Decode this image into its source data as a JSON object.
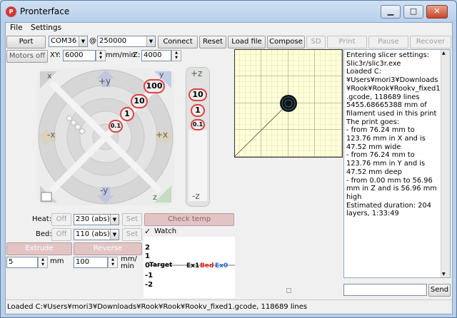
{
  "window": {
    "title": "Pronterface",
    "minimize": "▁",
    "maximize": "□",
    "close": "✕"
  },
  "menu": {
    "file": "File",
    "settings": "Settings"
  },
  "toolbar": {
    "port_label": "Port",
    "port_value": "COM36",
    "at": "@",
    "baud_value": "250000",
    "connect": "Connect",
    "reset": "Reset",
    "load_file": "Load file",
    "compose": "Compose",
    "sd": "SD",
    "print": "Print",
    "pause": "Pause",
    "recover": "Recover"
  },
  "motors": {
    "off_label": "Motors off",
    "xy_label": "XY:",
    "xy_value": "6000",
    "mm_min_label": "mm/min",
    "z_label": "Z:",
    "z_value": "4000"
  },
  "jog": {
    "y_plus": "+y",
    "y_minus": "-y",
    "x_minus": "-x",
    "x_plus": "+x",
    "y_home": "y",
    "x_home": "x",
    "z_home": "z",
    "steps": [
      "100",
      "10",
      "1",
      "0.1"
    ],
    "z_plus": "+z",
    "z_minus": "-z",
    "z_steps": [
      "10",
      "1",
      "0.1"
    ]
  },
  "temp": {
    "heat_label": "Heat:",
    "bed_label": "Bed:",
    "off": "Off",
    "heat_value": "230 (abs)",
    "bed_value": "110 (abs)",
    "set": "Set",
    "check_temp": "Check temp",
    "watch": "Watch"
  },
  "extrude": {
    "extrude": "Extrude",
    "reverse": "Reverse",
    "length": "5",
    "length_unit": "mm",
    "speed": "100",
    "speed_unit": "mm/\nmin"
  },
  "graph": {
    "ticks": [
      "2",
      "1",
      "0",
      "-1",
      "-2"
    ],
    "target": "Target",
    "ex1": "Ex1",
    "bed": "Bed",
    "ex0": "Ex0"
  },
  "console": {
    "log": "Entering slicer settings: Slic3r/slic3r.exe\nLoaded C:¥Users¥mori3¥Downloads¥Rook¥Rook¥Rookv_fixed1.gcode, 118689 lines\n5455.68665388 mm of filament used in this print\nThe print goes:\n- from 76.24 mm to 123.76 mm in X and is 47.52 mm wide\n- from 76.24 mm to 123.76 mm in Y and is 47.52 mm deep\n- from 0.00 mm to 56.96 mm in Z and is 56.96 mm high\nEstimated duration: 204 layers, 1:33:49",
    "send": "Send"
  },
  "status": "Loaded C:¥Users¥mori3¥Downloads¥Rook¥Rook¥Rookv_fixed1.gcode, 118689 lines",
  "colors": {
    "red": "#dd2222",
    "blue": "#2266dd",
    "grid_bg": "#ffffd8",
    "grid_line": "#c8c8a0"
  }
}
